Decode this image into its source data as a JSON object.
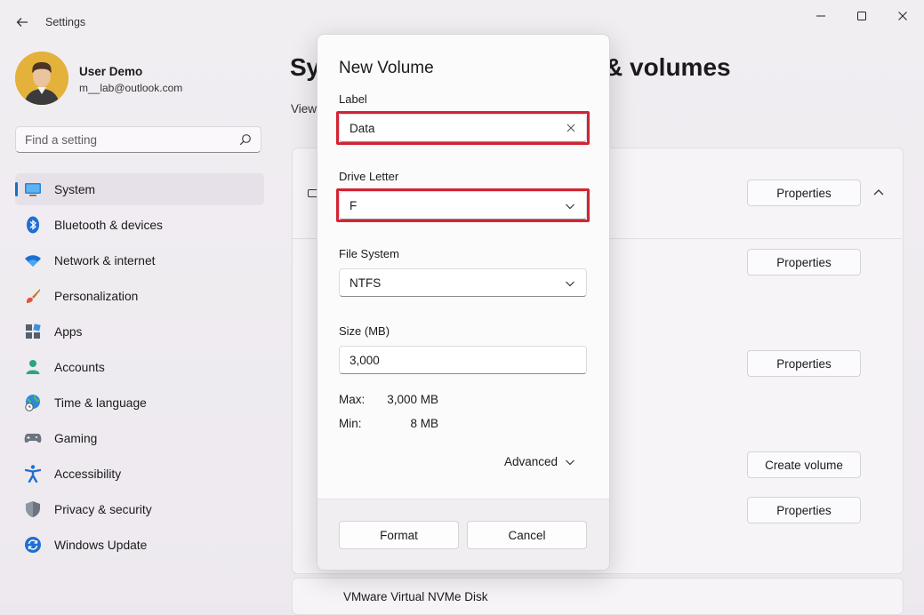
{
  "window": {
    "title": "Settings",
    "controls": {
      "minimize": "minimize-icon",
      "maximize": "maximize-icon",
      "close": "close-icon"
    }
  },
  "user": {
    "name": "User Demo",
    "email": "m__lab@outlook.com"
  },
  "search": {
    "placeholder": "Find a setting"
  },
  "sidebar": {
    "items": [
      {
        "label": "System",
        "icon": "monitor-icon",
        "active": true
      },
      {
        "label": "Bluetooth & devices",
        "icon": "bluetooth-icon"
      },
      {
        "label": "Network & internet",
        "icon": "wifi-icon"
      },
      {
        "label": "Personalization",
        "icon": "brush-icon"
      },
      {
        "label": "Apps",
        "icon": "apps-icon"
      },
      {
        "label": "Accounts",
        "icon": "person-icon"
      },
      {
        "label": "Time & language",
        "icon": "globe-clock-icon"
      },
      {
        "label": "Gaming",
        "icon": "gamepad-icon"
      },
      {
        "label": "Accessibility",
        "icon": "accessibility-icon"
      },
      {
        "label": "Privacy & security",
        "icon": "shield-icon"
      },
      {
        "label": "Windows Update",
        "icon": "sync-icon"
      }
    ]
  },
  "main": {
    "title_left": "Sy",
    "title_right": "& volumes",
    "view_text": "View",
    "buttons": {
      "properties": "Properties",
      "create_volume": "Create volume"
    },
    "bottom_card_label": "VMware Virtual NVMe Disk"
  },
  "dialog": {
    "title": "New Volume",
    "label": {
      "caption": "Label",
      "value": "Data"
    },
    "drive_letter": {
      "caption": "Drive Letter",
      "value": "F"
    },
    "file_system": {
      "caption": "File System",
      "value": "NTFS"
    },
    "size": {
      "caption": "Size (MB)",
      "value": "3,000"
    },
    "max": {
      "label": "Max:",
      "value": "3,000 MB"
    },
    "min": {
      "label": "Min:",
      "value": "8 MB"
    },
    "advanced": "Advanced",
    "format_button": "Format",
    "cancel_button": "Cancel",
    "highlight_color": "#d32433"
  }
}
